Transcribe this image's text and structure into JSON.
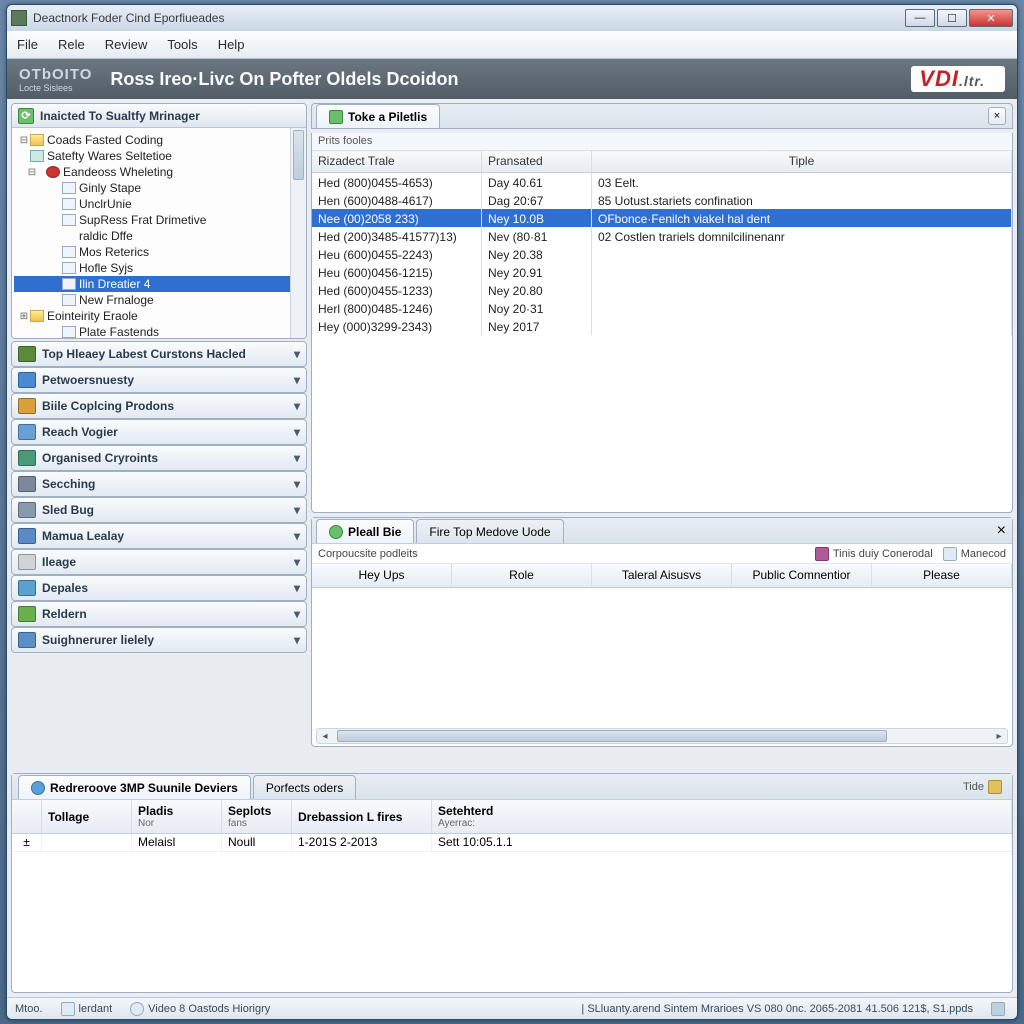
{
  "window": {
    "title": "Deactnork Foder Cind Eporfiueades"
  },
  "menu": [
    "File",
    "Rele",
    "Review",
    "Tools",
    "Help"
  ],
  "banner": {
    "logo_top": "OTbOITO",
    "logo_sub": "Locte Sislees",
    "title": "Ross Ireo·Livc  On Pofter Oldels Dcoidon",
    "brand": "VDI",
    "brand_suffix": ".ltr."
  },
  "tree_header": "Inaicted To Sualtfy Mrinager",
  "tree": [
    {
      "d": 0,
      "tw": "⊟",
      "ic": "fold",
      "t": "Coads Fasted Coding"
    },
    {
      "d": 0,
      "tw": "",
      "ic": "gear",
      "t": "Satefty Wares Seltetioe"
    },
    {
      "d": 1,
      "tw": "⊟",
      "ic": "redc",
      "t": "Eandeoss Wheleting"
    },
    {
      "d": 2,
      "tw": "",
      "ic": "doc",
      "t": "Ginly Stape"
    },
    {
      "d": 2,
      "tw": "",
      "ic": "doc",
      "t": "UnclrUnie"
    },
    {
      "d": 2,
      "tw": "",
      "ic": "doc",
      "t": "SupRess Frat Drimetive"
    },
    {
      "d": 2,
      "tw": "",
      "ic": "",
      "t": "raldic Dffe"
    },
    {
      "d": 2,
      "tw": "",
      "ic": "doc",
      "t": "Mos Reterics"
    },
    {
      "d": 2,
      "tw": "",
      "ic": "doc",
      "t": "Hofle Syjs"
    },
    {
      "d": 2,
      "tw": "",
      "ic": "doc",
      "t": "Ilin Dreatier 4",
      "sel": true
    },
    {
      "d": 2,
      "tw": "",
      "ic": "doc",
      "t": "New Frnaloge"
    },
    {
      "d": 0,
      "tw": "⊞",
      "ic": "fold",
      "t": "Eointeirity Eraole"
    },
    {
      "d": 2,
      "tw": "",
      "ic": "doc",
      "t": "Plate Fastends"
    }
  ],
  "accordion": [
    {
      "c": "#5a8a3a",
      "t": "Top Hleaey Labest Curstons Hacled"
    },
    {
      "c": "#4a8ad0",
      "t": "Petwoersnuesty"
    },
    {
      "c": "#d9a03a",
      "t": "Biile Coplcing Prodons"
    },
    {
      "c": "#6aa0d8",
      "t": "Reach Vogier"
    },
    {
      "c": "#4a9a7a",
      "t": "Organised Cryroints"
    },
    {
      "c": "#7a8a9a",
      "t": "Secching"
    },
    {
      "c": "#8a9aaa",
      "t": "Sled Bug"
    },
    {
      "c": "#5a8ac8",
      "t": "Mamua Lealay"
    },
    {
      "c": "#d0d4d8",
      "t": "Ileage"
    },
    {
      "c": "#5aa0d0",
      "t": "Depales"
    },
    {
      "c": "#6ab04a",
      "t": "Reldern"
    },
    {
      "c": "#5a90c8",
      "t": "Suighnerurer lielely"
    }
  ],
  "list": {
    "tab": "Toke a Piletlis",
    "sub": "Prits fooles",
    "cols": [
      "Rizadect Trale",
      "Pransated",
      "Tiple"
    ],
    "rows": [
      {
        "a": "Hed (800)0455-4653)",
        "b": "Day 40.61",
        "c": "03 Eelt."
      },
      {
        "a": "Hen (600)0488-4617)",
        "b": "Dag 20:67",
        "c": "85 Uotust.stariets confination"
      },
      {
        "a": "Nee (00)2058 233)",
        "b": "Ney 10.0B",
        "c": "OFbonce·Fenilch viakel hal dent",
        "sel": true
      },
      {
        "a": "Hed (200)3485-41577)13)",
        "b": "Nev (80·81",
        "c": "02 Costlen trariels domnilcilinenanr"
      },
      {
        "a": "Heu (600)0455-2243)",
        "b": "Ney 20.38",
        "c": ""
      },
      {
        "a": "Heu (600)0456-1215)",
        "b": "Ney 20.91",
        "c": ""
      },
      {
        "a": "Hed (600)0455-1233)",
        "b": "Ney 20.80",
        "c": ""
      },
      {
        "a": "Herl (800)0485-1246)",
        "b": "Noy 20·31",
        "c": ""
      },
      {
        "a": "Hey (000)3299-2343)",
        "b": "Ney 2017",
        "c": ""
      }
    ]
  },
  "detail": {
    "tab1": "Pleall Bie",
    "tab2": "Fire Top Medove Uode",
    "sub": "Corpoucsite podleits",
    "tool1": "Tinis duiy Conerodal",
    "tool2": "Manecod",
    "cols": [
      "Hey Ups",
      "Role",
      "Taleral Aisusvs",
      "Public Comnentior",
      "Please"
    ]
  },
  "bottom": {
    "tab1": "Redreroove 3MP Suunile Deviers",
    "tab2": "Porfects oders",
    "tide": "Tide",
    "cols": [
      {
        "h": "Tollage",
        "s": ""
      },
      {
        "h": "Pladis",
        "s": "Nor"
      },
      {
        "h": "Seplots",
        "s": "fans"
      },
      {
        "h": "Drebassion L fires",
        "s": ""
      },
      {
        "h": "Setehterd",
        "s": "Ayerrac:"
      }
    ],
    "row": [
      "",
      "Melaisl",
      "Noull",
      "1-201S 2-2013",
      "Sett 10:05.1.1"
    ]
  },
  "status": {
    "a": "Mtoo.",
    "b": "lerdant",
    "c": "Video 8 Oastods Hiorigry",
    "r": "| SLluanty.arend Sintem Mrarioes VS 080 0nc. 2065-2081 41.506 121$, S1.ppds"
  }
}
